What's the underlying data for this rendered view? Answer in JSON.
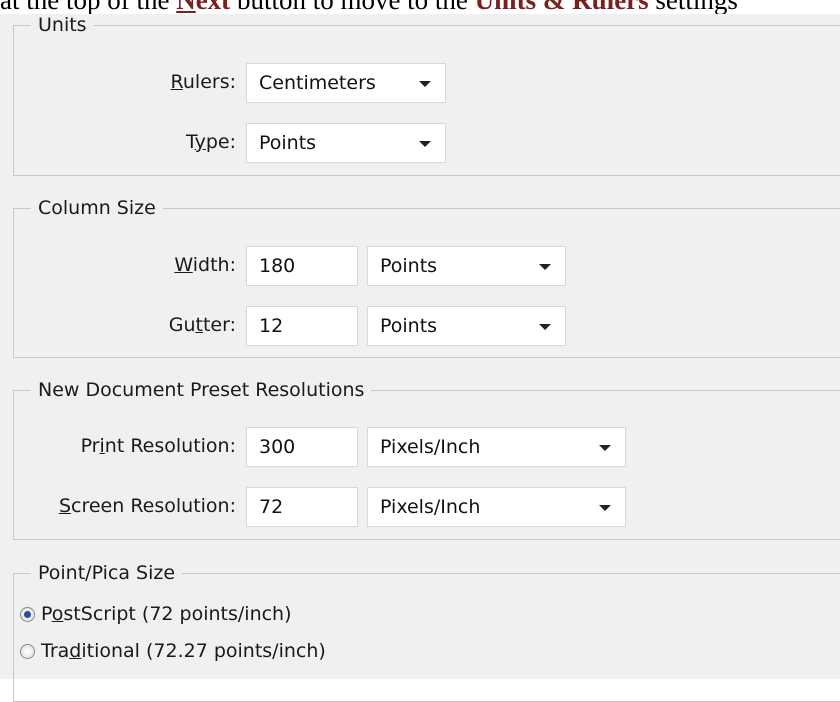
{
  "instruction": {
    "prefix": "at the top of the ",
    "next_letter": "N",
    "next_rest": "ext",
    "middle": " button to move to the ",
    "highlight": "Units & Rulers",
    "suffix": " settings"
  },
  "units": {
    "legend": "Units",
    "rulers_label": {
      "hotkey": "R",
      "rest": "ulers:"
    },
    "rulers_value": "Centimeters",
    "type_label": {
      "before": "T",
      "hotkey": "y",
      "rest": "pe:"
    },
    "type_value": "Points"
  },
  "column_size": {
    "legend": "Column Size",
    "width_label": {
      "hotkey": "W",
      "rest": "idth:"
    },
    "width_value": "180",
    "width_unit": "Points",
    "gutter_label": {
      "before": "Gu",
      "hotkey": "t",
      "rest": "ter:"
    },
    "gutter_value": "12",
    "gutter_unit": "Points"
  },
  "preset_resolutions": {
    "legend": "New Document Preset Resolutions",
    "print_label": {
      "before": "Pr",
      "hotkey": "i",
      "rest": "nt Resolution:"
    },
    "print_value": "300",
    "print_unit": "Pixels/Inch",
    "screen_label": {
      "hotkey": "S",
      "rest": "creen Resolution:"
    },
    "screen_value": "72",
    "screen_unit": "Pixels/Inch"
  },
  "point_pica": {
    "legend": "Point/Pica Size",
    "postscript": {
      "before": "P",
      "hotkey": "o",
      "rest": "stScript (72 points/inch)",
      "checked": true
    },
    "traditional": {
      "before": "Tra",
      "hotkey": "d",
      "rest": "itional (72.27 points/inch)",
      "checked": false
    }
  }
}
